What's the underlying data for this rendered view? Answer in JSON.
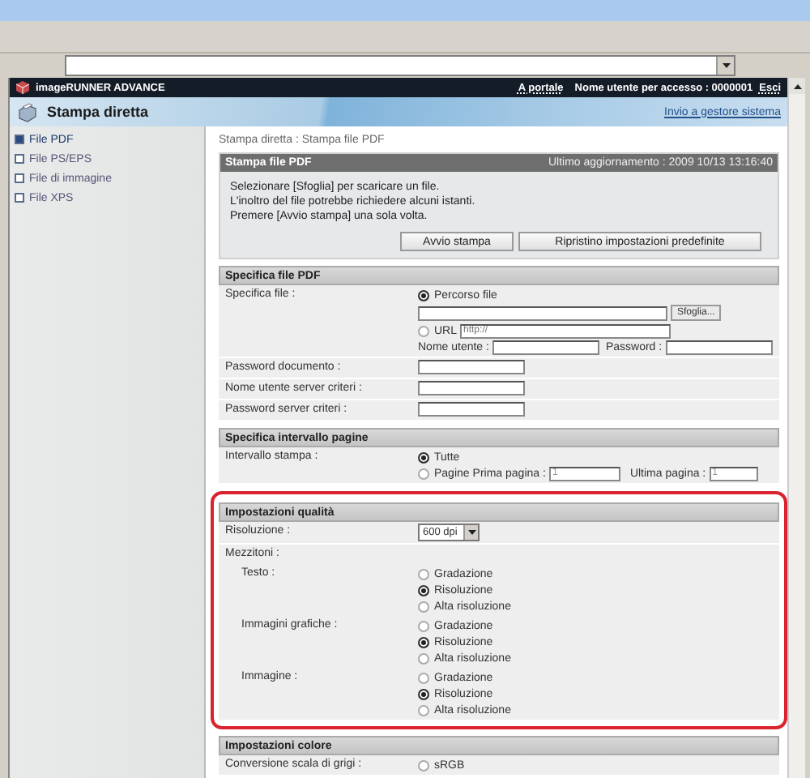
{
  "header": {
    "product": "imageRUNNER ADVANCE",
    "portal_link": "A portale",
    "user": "Nome utente per accesso : 0000001",
    "logout_link": "Esci"
  },
  "banner": {
    "title": "Stampa diretta",
    "admin_link": "Invio a gestore sistema"
  },
  "sidebar": {
    "items": [
      {
        "label": "File PDF",
        "selected": true
      },
      {
        "label": "File PS/EPS",
        "selected": false
      },
      {
        "label": "File di immagine",
        "selected": false
      },
      {
        "label": "File XPS",
        "selected": false
      }
    ]
  },
  "breadcrumb": "Stampa diretta : Stampa file PDF",
  "print_panel": {
    "title": "Stampa file PDF",
    "updated": "Ultimo aggiornamento : 2009 10/13 13:16:40",
    "lines": [
      "Selezionare [Sfoglia] per scaricare un file.",
      "L'inoltro del file potrebbe richiedere alcuni istanti.",
      "Premere [Avvio stampa] una sola volta."
    ],
    "buttons": [
      "Avvio stampa",
      "Ripristino impostazioni predefinite"
    ]
  },
  "sections": [
    {
      "title": "Specifica file PDF",
      "highlighted": false,
      "rows": [
        {
          "kind": "file_source",
          "label": "Specifica file :",
          "options": [
            {
              "label": "Percorso file",
              "selected": true
            },
            {
              "label": "URL",
              "selected": false
            }
          ],
          "browse_button": "Sfoglia...",
          "url_placeholder": "http://",
          "user_label": "Nome utente :",
          "password_label": "Password :"
        },
        {
          "kind": "input",
          "label": "Password documento :"
        },
        {
          "kind": "input",
          "label": "Nome utente server criteri :"
        },
        {
          "kind": "input",
          "label": "Password server criteri :"
        }
      ]
    },
    {
      "title": "Specifica intervallo pagine",
      "highlighted": false,
      "rows": [
        {
          "kind": "page_range",
          "label": "Intervallo stampa :",
          "options": [
            {
              "label": "Tutte",
              "selected": true
            },
            {
              "label": "Pagine",
              "selected": false
            }
          ],
          "first_label": "Prima pagina :",
          "first_value": "1",
          "last_label": "Ultima pagina :",
          "last_value": "1"
        }
      ]
    },
    {
      "title": "Impostazioni qualità",
      "highlighted": true,
      "rows": [
        {
          "kind": "select",
          "label": "Risoluzione :",
          "value": "600 dpi"
        },
        {
          "kind": "group",
          "label": "Mezzitoni :",
          "children": [
            {
              "kind": "radio",
              "label": "Testo :",
              "options": [
                {
                  "label": "Gradazione",
                  "selected": false
                },
                {
                  "label": "Risoluzione",
                  "selected": true
                },
                {
                  "label": "Alta risoluzione",
                  "selected": false
                }
              ]
            },
            {
              "kind": "radio",
              "label": "Immagini grafiche :",
              "options": [
                {
                  "label": "Gradazione",
                  "selected": false
                },
                {
                  "label": "Risoluzione",
                  "selected": true
                },
                {
                  "label": "Alta risoluzione",
                  "selected": false
                }
              ]
            },
            {
              "kind": "radio",
              "label": "Immagine :",
              "options": [
                {
                  "label": "Gradazione",
                  "selected": false
                },
                {
                  "label": "Risoluzione",
                  "selected": true
                },
                {
                  "label": "Alta risoluzione",
                  "selected": false
                }
              ]
            }
          ]
        }
      ]
    },
    {
      "title": "Impostazioni colore",
      "highlighted": false,
      "rows": [
        {
          "kind": "radio",
          "label": "Conversione scala di grigi :",
          "options": [
            {
              "label": "sRGB",
              "selected": false
            }
          ]
        }
      ]
    }
  ]
}
